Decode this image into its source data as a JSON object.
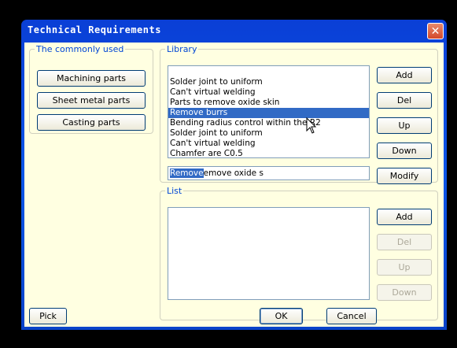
{
  "window": {
    "title": "Technical Requirements"
  },
  "common": {
    "legend": "The commonly used",
    "buttons": [
      "Machining parts",
      "Sheet metal parts",
      "Casting parts"
    ]
  },
  "library": {
    "legend": "Library",
    "items": [
      "Solder joint to uniform",
      "Can't virtual welding",
      "Parts to remove oxide skin",
      "Remove burrs",
      "Bending radius control within the R2",
      "Solder joint to uniform",
      "Can't virtual welding",
      "Chamfer are C0.5"
    ],
    "selected_index": 3,
    "edit_selected": "Remove",
    "edit_rest": "emove oxide s",
    "buttons": {
      "add": "Add",
      "del": "Del",
      "up": "Up",
      "down": "Down",
      "modify": "Modify"
    }
  },
  "list": {
    "legend": "List",
    "buttons": {
      "add": "Add",
      "del": "Del",
      "up": "Up",
      "down": "Down"
    }
  },
  "footer": {
    "pick": "Pick",
    "ok": "OK",
    "cancel": "Cancel"
  },
  "icons": {
    "close": "close-icon",
    "cursor": "mouse-pointer-icon"
  }
}
